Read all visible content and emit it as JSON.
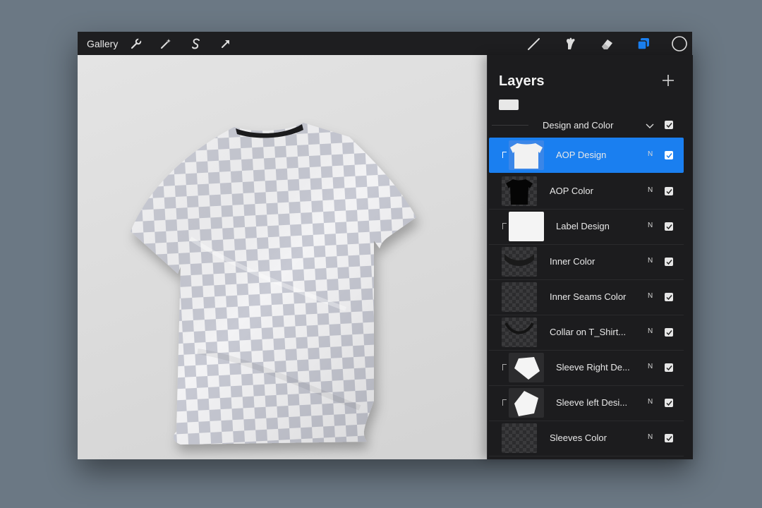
{
  "toolbar": {
    "gallery_label": "Gallery",
    "left_icons": [
      "wrench-icon",
      "magic-wand-icon",
      "selection-s-icon",
      "transform-arrow-icon"
    ],
    "right_icons": [
      "brush-icon",
      "smudge-icon",
      "eraser-icon",
      "layers-icon",
      "color-swatch-icon"
    ],
    "accent_color": "#1a7ff0"
  },
  "layers_panel": {
    "title": "Layers",
    "add_icon": "plus-icon",
    "group": {
      "name": "Design and Color",
      "expand_icon": "chevron-down-icon",
      "visible": true
    },
    "layers": [
      {
        "name": "AOP Design",
        "blend_mode": "N",
        "visible": true,
        "selected": true,
        "clipped": true,
        "thumb": "white-shirt"
      },
      {
        "name": "AOP Color",
        "blend_mode": "N",
        "visible": true,
        "selected": false,
        "clipped": false,
        "thumb": "black-shirt"
      },
      {
        "name": "Label Design",
        "blend_mode": "N",
        "visible": true,
        "selected": false,
        "clipped": true,
        "thumb": "white-square"
      },
      {
        "name": "Inner Color",
        "blend_mode": "N",
        "visible": true,
        "selected": false,
        "clipped": false,
        "thumb": "inner-dark"
      },
      {
        "name": "Inner Seams Color",
        "blend_mode": "N",
        "visible": true,
        "selected": false,
        "clipped": false,
        "thumb": "checker"
      },
      {
        "name": "Collar on T_Shirt...",
        "blend_mode": "N",
        "visible": true,
        "selected": false,
        "clipped": false,
        "thumb": "collar"
      },
      {
        "name": "Sleeve Right De...",
        "blend_mode": "N",
        "visible": true,
        "selected": false,
        "clipped": true,
        "thumb": "sleeve-right"
      },
      {
        "name": "Sleeve left Desi...",
        "blend_mode": "N",
        "visible": true,
        "selected": false,
        "clipped": true,
        "thumb": "sleeve-left"
      },
      {
        "name": "Sleeves Color",
        "blend_mode": "N",
        "visible": true,
        "selected": false,
        "clipped": false,
        "thumb": "checker"
      }
    ]
  },
  "canvas": {
    "subject": "t-shirt mockup with transparency checkerboard",
    "collar_color": "#1b1b1d"
  }
}
